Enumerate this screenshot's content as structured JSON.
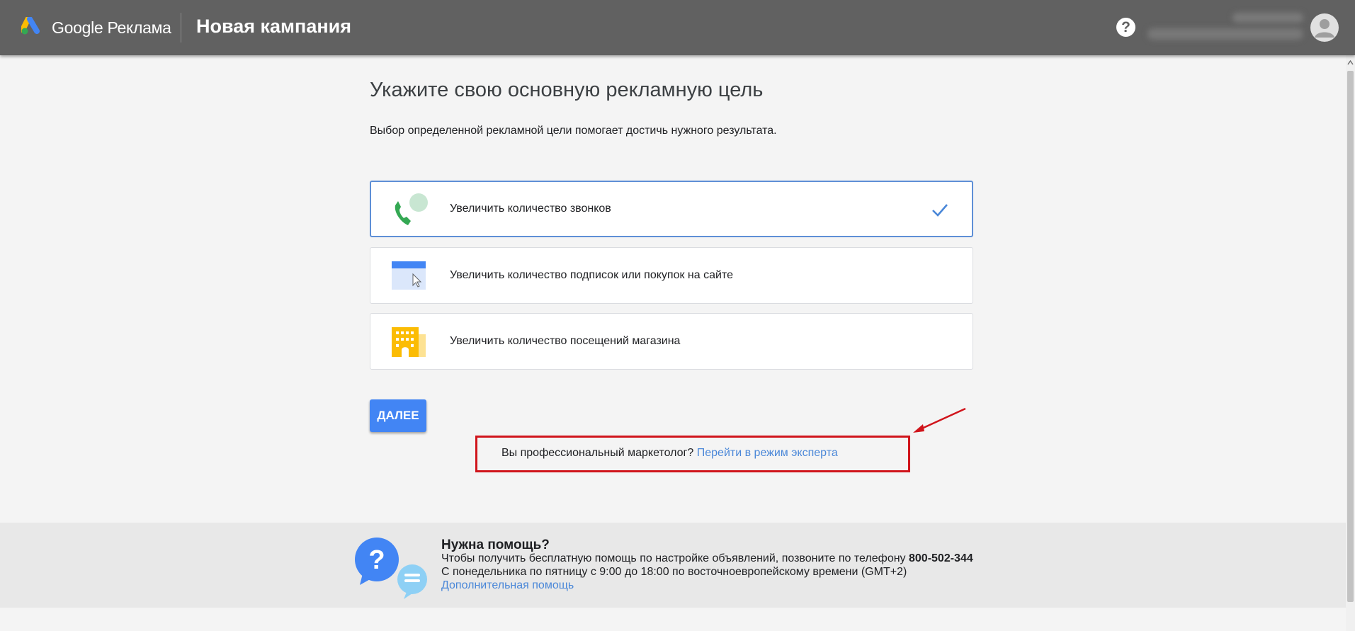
{
  "header": {
    "brand": "Google Реклама",
    "campaign_title": "Новая кампания",
    "help_symbol": "?"
  },
  "main": {
    "heading": "Укажите свою основную рекламную цель",
    "subtext": "Выбор определенной рекламной цели помогает достичь нужного результата.",
    "goals": [
      {
        "label": "Увеличить количество звонков",
        "icon": "phone-call-icon",
        "selected": true
      },
      {
        "label": "Увеличить количество подписок или покупок на сайте",
        "icon": "website-click-icon",
        "selected": false
      },
      {
        "label": "Увеличить количество посещений магазина",
        "icon": "store-building-icon",
        "selected": false
      }
    ],
    "next_label": "ДАЛЕЕ",
    "expert": {
      "question": "Вы профессиональный маркетолог?",
      "link": "Перейти в режим эксперта"
    }
  },
  "footer": {
    "title": "Нужна помощь?",
    "line1": "Чтобы получить бесплатную помощь по настройке объявлений, позвоните по телефону",
    "phone": "800-502-344",
    "line2": "С понедельника по пятницу с 9:00 до 18:00 по восточноевропейскому времени (GMT+2)",
    "link": "Дополнительная помощь"
  },
  "colors": {
    "header_bg": "#616161",
    "accent_blue": "#4285f4",
    "link_blue": "#4a87d8",
    "annotation_red": "#d0141b",
    "selected_border": "#5e8fd6"
  }
}
